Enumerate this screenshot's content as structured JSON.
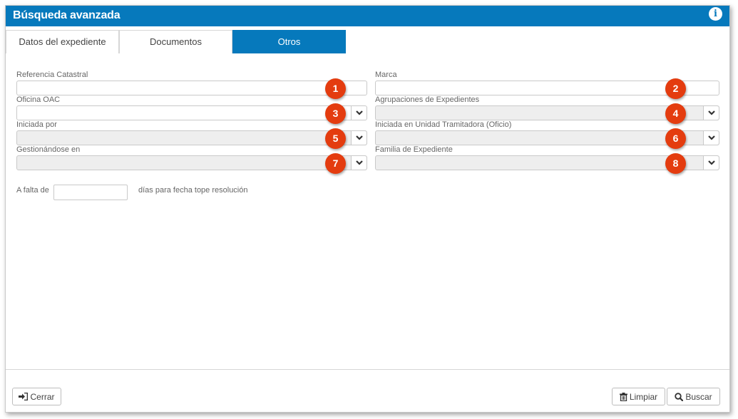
{
  "window": {
    "title": "Búsqueda avanzada",
    "info_icon": "info-circle-icon"
  },
  "tabs": [
    {
      "label": "Datos del expediente",
      "active": false
    },
    {
      "label": "Documentos",
      "active": false
    },
    {
      "label": "Otros",
      "active": true
    }
  ],
  "form": {
    "referencia_catastral": {
      "label": "Referencia Catastral",
      "value": "",
      "badge": "1"
    },
    "marca": {
      "label": "Marca",
      "value": "",
      "badge": "2"
    },
    "oficina_oac": {
      "label": "Oficina OAC",
      "value": "",
      "badge": "3"
    },
    "agrupaciones": {
      "label": "Agrupaciones de Expedientes",
      "value": "",
      "badge": "4"
    },
    "iniciada_por": {
      "label": "Iniciada por",
      "value": "",
      "badge": "5"
    },
    "iniciada_unidad": {
      "label": "Iniciada en Unidad Tramitadora (Oficio)",
      "value": "",
      "badge": "6"
    },
    "gestionandose": {
      "label": "Gestionándose en",
      "value": "",
      "badge": "7"
    },
    "familia": {
      "label": "Familia de Expediente",
      "value": "",
      "badge": "8"
    },
    "falta": {
      "prefix": "A falta de",
      "value": "",
      "suffix": "días para fecha tope resolución"
    }
  },
  "footer": {
    "cerrar_label": "Cerrar",
    "limpiar_label": "Limpiar",
    "buscar_label": "Buscar"
  },
  "colors": {
    "header": "#0679bc",
    "badge": "#e43c0f"
  }
}
